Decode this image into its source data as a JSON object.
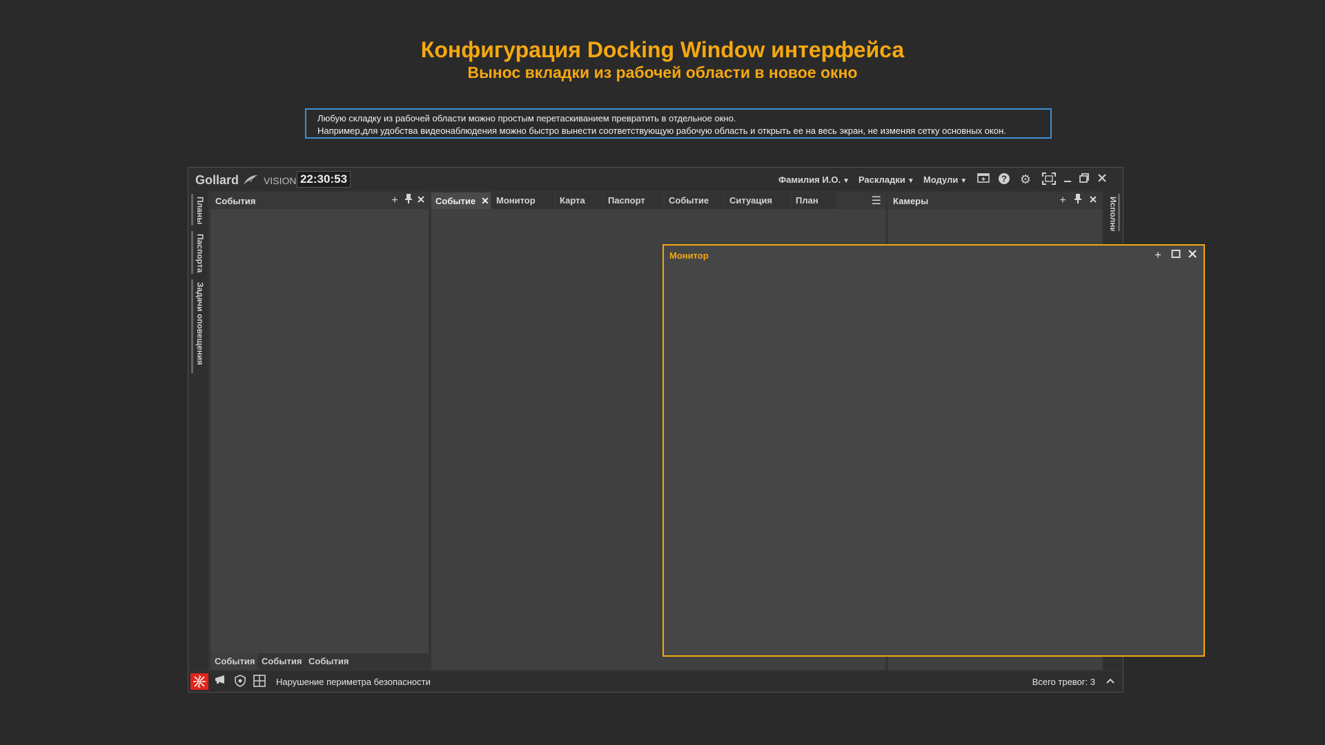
{
  "header": {
    "title": "Конфигурация Docking Window интерфейса",
    "subtitle": "Вынос вкладки из рабочей области в новое окно"
  },
  "info": {
    "line1": "Любую складку из рабочей области можно простым перетаскиванием превратить в отдельное окно.",
    "line2": "Например,для удобства видеонаблюдения можно быстро вынести соответствующую рабочую область и открыть ее на весь экран, не изменяя сетку основных окон."
  },
  "app": {
    "logo": "Gollard",
    "logo_suffix": "VISION",
    "clock": "22:30:53",
    "menus": [
      "Фамилия И.О.",
      "Раскладки",
      "Модули"
    ],
    "icons": [
      "window-icon",
      "help-icon",
      "gear-icon",
      "fullscreen-icon",
      "minimize-icon",
      "restore-icon",
      "close-icon"
    ]
  },
  "sidebar": {
    "tabs": [
      "Планы",
      "Паспорта",
      "Задачи оповещения"
    ]
  },
  "right_sidebar": {
    "tab": "Исполнител"
  },
  "left_panel": {
    "title": "События",
    "bottom_tabs": [
      "События",
      "События",
      "События"
    ]
  },
  "center_panel": {
    "tabs": [
      "Событие",
      "Монитор",
      "Карта",
      "Паспорт",
      "Событие",
      "Ситуация",
      "План"
    ]
  },
  "right_panel": {
    "title": "Камеры"
  },
  "floating_window": {
    "title": "Монитор"
  },
  "statusbar": {
    "message": "Нарушение периметра безопасности",
    "total": "Всего тревог: 3"
  },
  "colors": {
    "accent": "#f5a810",
    "info_border": "#3d8fd6",
    "alarm": "#e0241b"
  }
}
